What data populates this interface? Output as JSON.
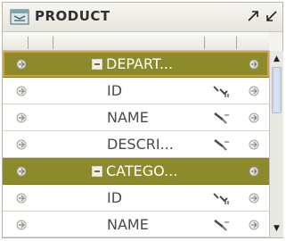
{
  "window": {
    "title": "PRODUCT",
    "maximize_icon": "maximize-icon",
    "restore_icon": "restore-icon"
  },
  "colors": {
    "table_row_bg": "#8c8a2a",
    "selection_outline": "#d8a13b",
    "field_row_bg": "#ffffff",
    "scroll_thumb": "#c9d6ea"
  },
  "rows": [
    {
      "kind": "table",
      "label": "DEPART...",
      "selected": true
    },
    {
      "kind": "field",
      "label": "ID",
      "type_icon": "key-relation-icon"
    },
    {
      "kind": "field",
      "label": "NAME",
      "type_icon": "edit-pencil-icon"
    },
    {
      "kind": "field",
      "label": "DESCRI...",
      "type_icon": "edit-pencil-icon"
    },
    {
      "kind": "table",
      "label": "CATEGO...",
      "selected": false
    },
    {
      "kind": "field",
      "label": "ID",
      "type_icon": "key-relation-icon"
    },
    {
      "kind": "field",
      "label": "NAME",
      "type_icon": "edit-pencil-icon"
    }
  ]
}
